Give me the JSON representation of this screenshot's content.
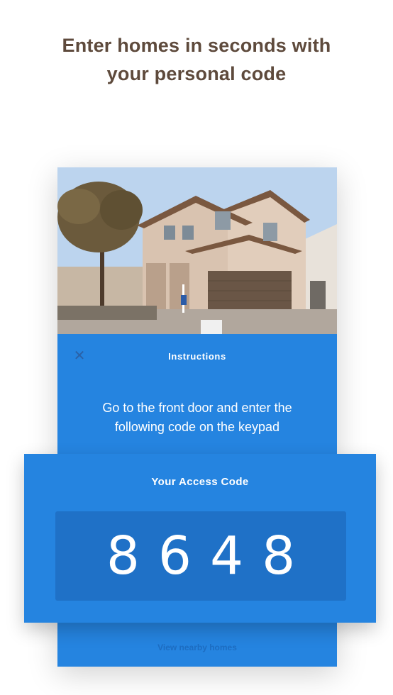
{
  "headline": {
    "line1": "Enter homes in seconds with",
    "line2": "your personal code"
  },
  "instructions": {
    "title": "Instructions",
    "close_icon": "close-icon",
    "text_line1": "Go to the front door and enter the",
    "text_line2": "following code on the keypad"
  },
  "access": {
    "title": "Your Access Code",
    "code": "8648"
  },
  "links": {
    "view_nearby": "View nearby homes"
  },
  "colors": {
    "primary_blue": "#2584e0",
    "code_box": "#1f71c7",
    "headline_brown": "#5e4a3c"
  }
}
